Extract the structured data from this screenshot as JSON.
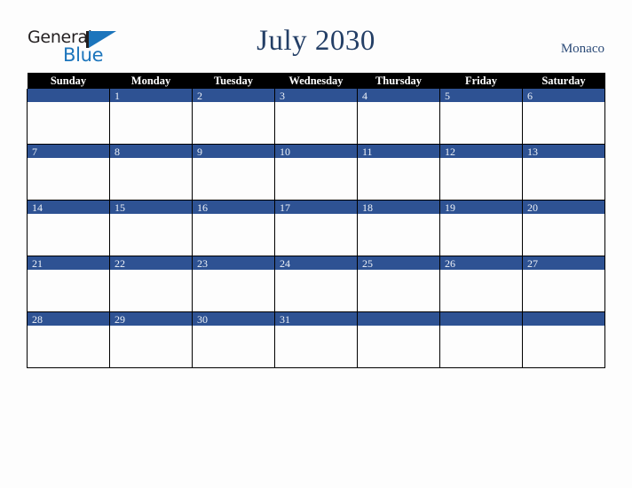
{
  "brand": {
    "name_part1": "General",
    "name_part2": "Blue",
    "mark_icon": "triangle-logo-icon"
  },
  "header": {
    "title": "July 2030",
    "locale": "Monaco"
  },
  "calendar": {
    "weekday_headers": [
      "Sunday",
      "Monday",
      "Tuesday",
      "Wednesday",
      "Thursday",
      "Friday",
      "Saturday"
    ],
    "weeks": [
      [
        "",
        "1",
        "2",
        "3",
        "4",
        "5",
        "6"
      ],
      [
        "7",
        "8",
        "9",
        "10",
        "11",
        "12",
        "13"
      ],
      [
        "14",
        "15",
        "16",
        "17",
        "18",
        "19",
        "20"
      ],
      [
        "21",
        "22",
        "23",
        "24",
        "25",
        "26",
        "27"
      ],
      [
        "28",
        "29",
        "30",
        "31",
        "",
        "",
        ""
      ]
    ]
  },
  "colors": {
    "header_black": "#000000",
    "band_blue": "#2e5293",
    "title_navy": "#243f66",
    "brand_blue": "#1c75bc",
    "page_background": "#fdfdfd"
  }
}
